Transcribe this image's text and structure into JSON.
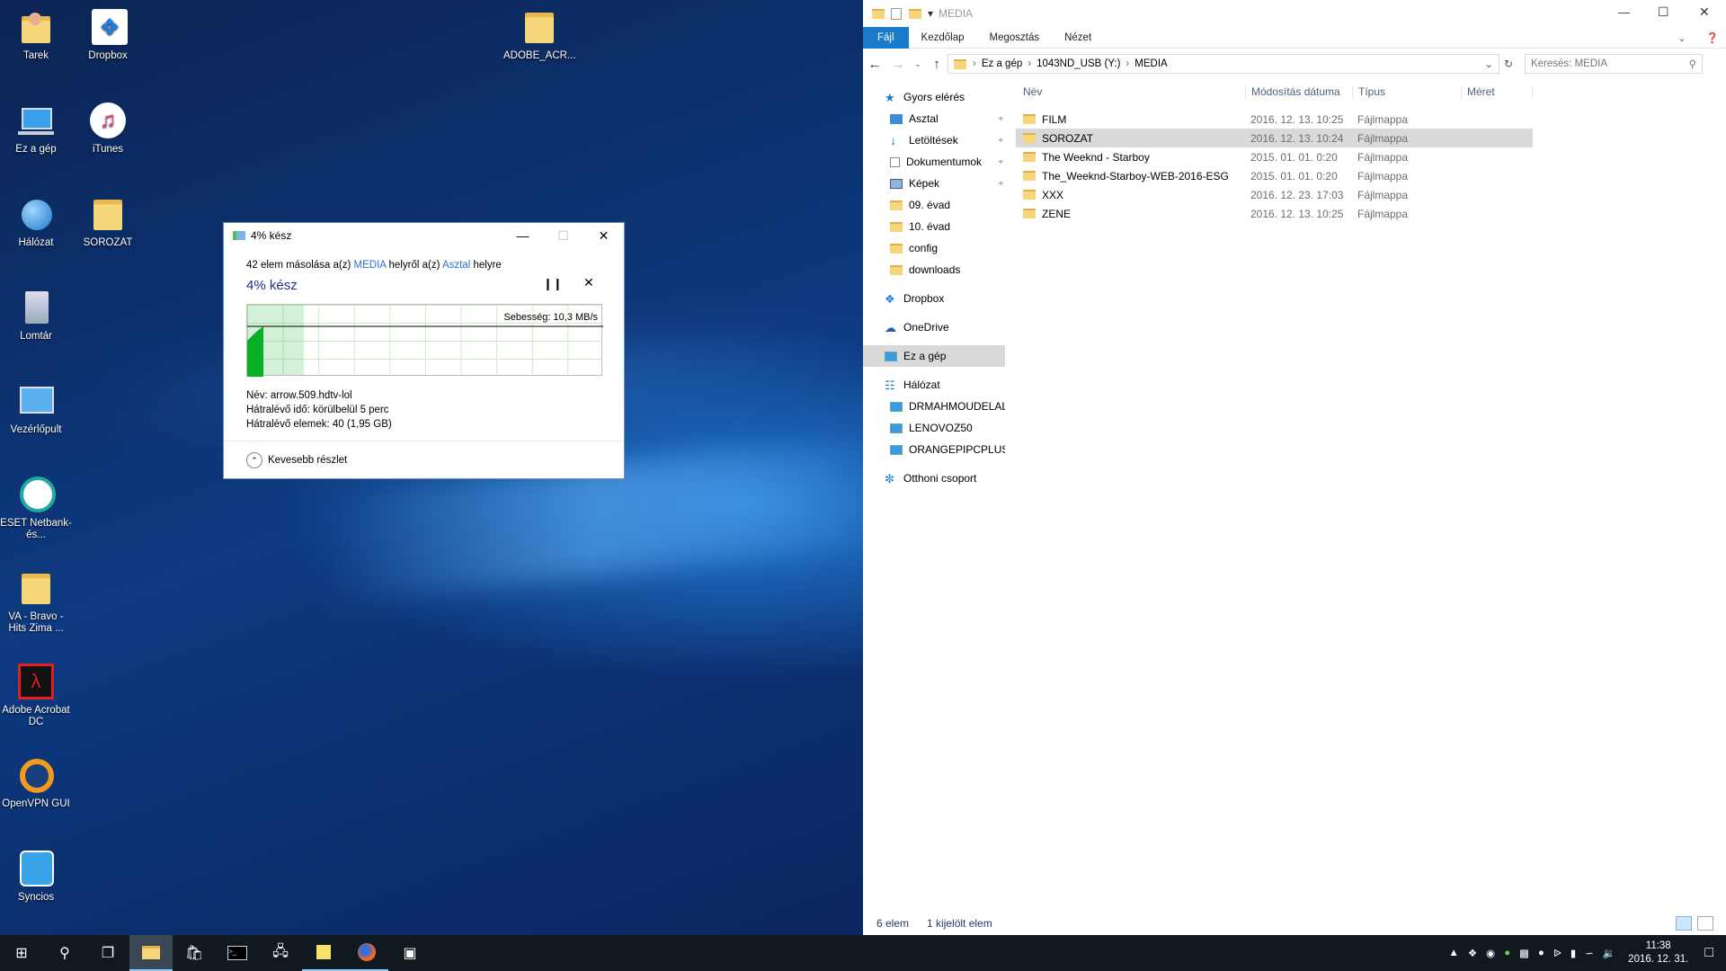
{
  "desktop": {
    "icons": [
      {
        "label": "Tarek",
        "icon": "user-folder-icon"
      },
      {
        "label": "Dropbox",
        "icon": "dropbox-icon"
      },
      {
        "label": "Ez a gép",
        "icon": "computer-icon"
      },
      {
        "label": "iTunes",
        "icon": "itunes-icon"
      },
      {
        "label": "Hálózat",
        "icon": "network-icon"
      },
      {
        "label": "SOROZAT",
        "icon": "folder-icon"
      },
      {
        "label": "Lomtár",
        "icon": "recycle-bin-icon"
      },
      {
        "label": "Vezérlőpult",
        "icon": "control-panel-icon"
      },
      {
        "label": "ESET Netbank- és...",
        "icon": "eset-icon"
      },
      {
        "label": "VA - Bravo - Hits Zima ...",
        "icon": "folder-icon"
      },
      {
        "label": "Adobe Acrobat DC",
        "icon": "acrobat-icon"
      },
      {
        "label": "OpenVPN GUI",
        "icon": "openvpn-icon"
      },
      {
        "label": "Syncios",
        "icon": "syncios-icon"
      },
      {
        "label": "ADOBE_ACR...",
        "icon": "folder-icon"
      }
    ]
  },
  "copy_dialog": {
    "title": "4% kész",
    "summary_pre": "42 elem másolása a(z) ",
    "summary_src": "MEDIA",
    "summary_mid": " helyről a(z) ",
    "summary_dst": "Asztal",
    "summary_post": " helyre",
    "progress_label": "4% kész",
    "progress": 0.04,
    "speed": "Sebesség: 10,3 MB/s",
    "name": "Név:  arrow.509.hdtv-lol",
    "time_left": "Hátralévő idő:  körülbelül 5 perc",
    "items_left": "Hátralévő elemek:  40 (1,95 GB)",
    "less_details": "Kevesebb részlet"
  },
  "explorer": {
    "title": "MEDIA",
    "ribbon": [
      "Fájl",
      "Kezdőlap",
      "Megosztás",
      "Nézet"
    ],
    "path": [
      "Ez a gép",
      "1043ND_USB (Y:)",
      "MEDIA"
    ],
    "search_placeholder": "Keresés: MEDIA",
    "nav": [
      {
        "label": "Gyors elérés",
        "type": "star",
        "indent": 0
      },
      {
        "label": "Asztal",
        "type": "desktop",
        "indent": 1,
        "pin": true
      },
      {
        "label": "Letöltések",
        "type": "download",
        "indent": 1,
        "pin": true
      },
      {
        "label": "Dokumentumok",
        "type": "doc",
        "indent": 1,
        "pin": true
      },
      {
        "label": "Képek",
        "type": "pic",
        "indent": 1,
        "pin": true
      },
      {
        "label": "09. évad",
        "type": "folder",
        "indent": 1
      },
      {
        "label": "10. évad",
        "type": "folder",
        "indent": 1
      },
      {
        "label": "config",
        "type": "folder",
        "indent": 1
      },
      {
        "label": "downloads",
        "type": "folder",
        "indent": 1
      },
      {
        "label": "Dropbox",
        "type": "dropbox",
        "indent": 0,
        "gap": true
      },
      {
        "label": "OneDrive",
        "type": "cloud",
        "indent": 0,
        "gap": true
      },
      {
        "label": "Ez a gép",
        "type": "pc",
        "indent": 0,
        "gap": true,
        "selected": true
      },
      {
        "label": "Hálózat",
        "type": "net",
        "indent": 0,
        "gap": true
      },
      {
        "label": "DRMAHMOUDELAL",
        "type": "pc",
        "indent": 1
      },
      {
        "label": "LENOVOZ50",
        "type": "pc",
        "indent": 1
      },
      {
        "label": "ORANGEPIPCPLUS",
        "type": "pc",
        "indent": 1
      },
      {
        "label": "Otthoni csoport",
        "type": "home",
        "indent": 0,
        "gap": true
      }
    ],
    "columns": [
      "Név",
      "Módosítás dátuma",
      "Típus",
      "Méret"
    ],
    "files": [
      {
        "name": "FILM",
        "date": "2016. 12. 13. 10:25",
        "type": "Fájlmappa"
      },
      {
        "name": "SOROZAT",
        "date": "2016. 12. 13. 10:24",
        "type": "Fájlmappa",
        "selected": true
      },
      {
        "name": "The Weeknd - Starboy",
        "date": "2015. 01. 01. 0:20",
        "type": "Fájlmappa"
      },
      {
        "name": "The_Weeknd-Starboy-WEB-2016-ESG",
        "date": "2015. 01. 01. 0:20",
        "type": "Fájlmappa"
      },
      {
        "name": "XXX",
        "date": "2016. 12. 23. 17:03",
        "type": "Fájlmappa"
      },
      {
        "name": "ZENE",
        "date": "2016. 12. 13. 10:25",
        "type": "Fájlmappa"
      }
    ],
    "status_count": "6 elem",
    "status_selected": "1 kijelölt elem"
  },
  "taskbar": {
    "time": "11:38",
    "date": "2016. 12. 31."
  },
  "colors": {
    "accent": "#1979ca",
    "selection": "#d9d9d9",
    "progress": "#06b025"
  }
}
